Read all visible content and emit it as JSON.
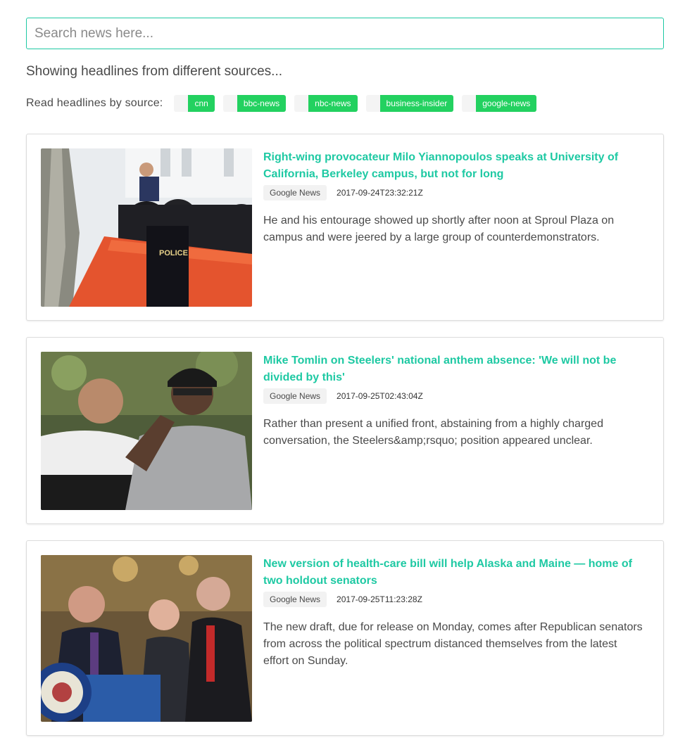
{
  "search": {
    "placeholder": "Search news here..."
  },
  "heading": "Showing headlines from different sources...",
  "sources": {
    "label": "Read headlines by source:",
    "items": [
      "cnn",
      "bbc-news",
      "nbc-news",
      "business-insider",
      "google-news"
    ]
  },
  "colors": {
    "accent": "#1ec9a3",
    "tag": "#23d160"
  },
  "articles": [
    {
      "title": "Right-wing provocateur Milo Yiannopoulos speaks at University of California, Berkeley campus, but not for long",
      "source": "Google News",
      "date": "2017-09-24T23:32:21Z",
      "description": "He and his entourage showed up shortly after noon at Sproul Plaza on campus and were jeered by a large group of counterdemonstrators.",
      "image_text": "POLICE"
    },
    {
      "title": "Mike Tomlin on Steelers' national anthem absence: 'We will not be divided by this'",
      "source": "Google News",
      "date": "2017-09-25T02:43:04Z",
      "description": "Rather than present a unified front, abstaining from a highly charged conversation, the Steelers&amp;rsquo; position appeared unclear."
    },
    {
      "title": "New version of health-care bill will help Alaska and Maine — home of two holdout senators",
      "source": "Google News",
      "date": "2017-09-25T11:23:28Z",
      "description": "The new draft, due for release on Monday, comes after Republican senators from across the political spectrum distanced themselves from the latest effort on Sunday."
    }
  ]
}
